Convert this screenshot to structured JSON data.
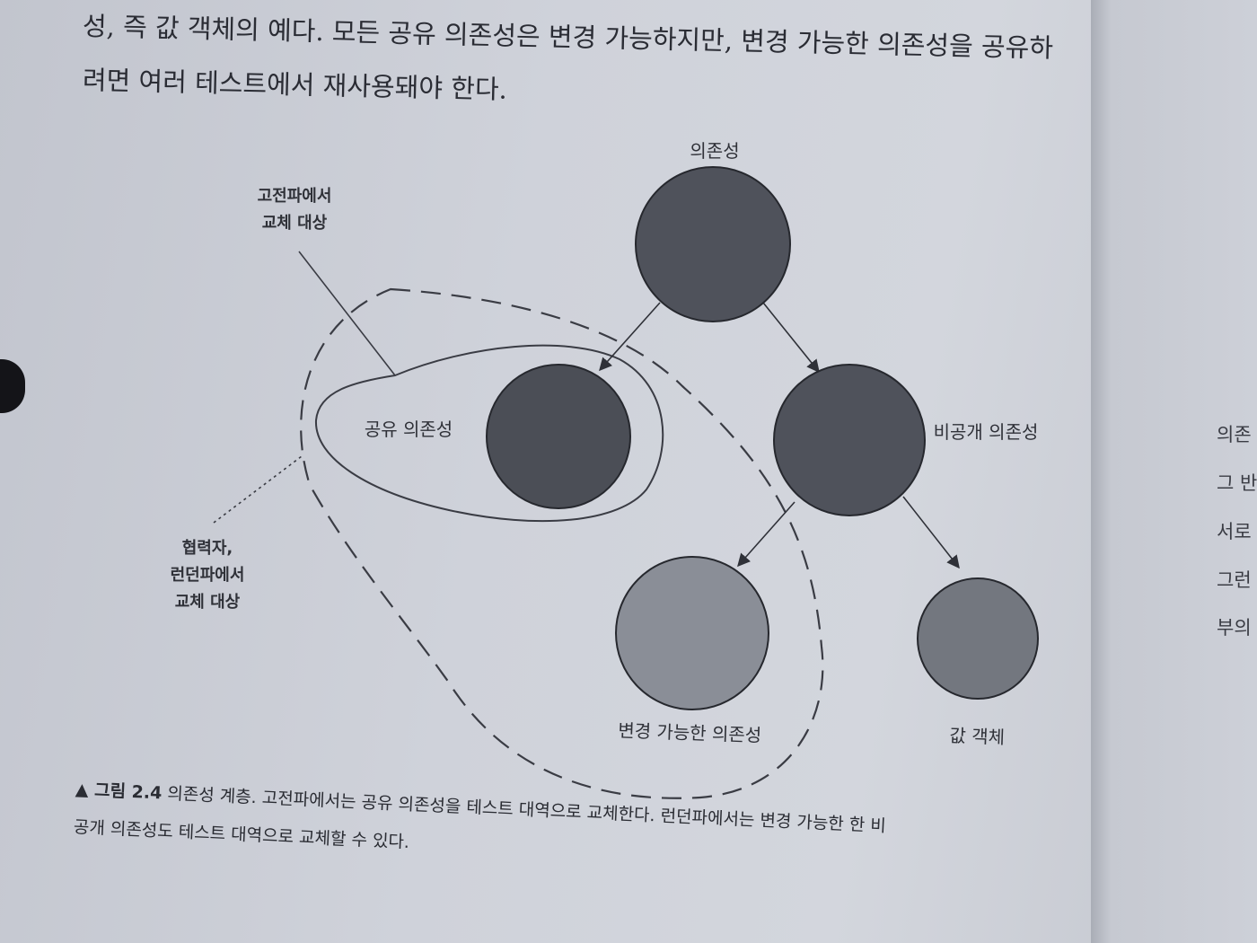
{
  "body_text": {
    "line1": "성, 즉 값 객체의 예다. 모든 공유 의존성은 변경 가능하지만, 변경 가능한 의존성을 공유하",
    "line2": "려면 여러 테스트에서 재사용돼야 한다."
  },
  "diagram": {
    "nodes": {
      "dependency": "의존성",
      "shared": "공유 의존성",
      "private": "비공개 의존성",
      "mutable": "변경 가능한 의존성",
      "value_object": "값 객체"
    },
    "annotations": {
      "classical_line1": "고전파에서",
      "classical_line2": "교체 대상",
      "london_line1": "협력자,",
      "london_line2": "런던파에서",
      "london_line3": "교체 대상"
    },
    "colors": {
      "root_fill": "#4f525b",
      "shared_fill": "#4b4e56",
      "private_fill": "#4f525b",
      "mutable_fill": "#8a8e97",
      "value_fill": "#73777f"
    }
  },
  "caption": {
    "label": "▲ 그림 2.4",
    "line1": "의존성 계층. 고전파에서는 공유 의존성을 테스트 대역으로 교체한다. 런던파에서는 변경 가능한 한 비",
    "line2": "공개 의존성도 테스트 대역으로 교체할 수 있다."
  },
  "next_page_lines": [
    "의존",
    "그 반",
    "서로",
    "그런",
    "부의"
  ]
}
